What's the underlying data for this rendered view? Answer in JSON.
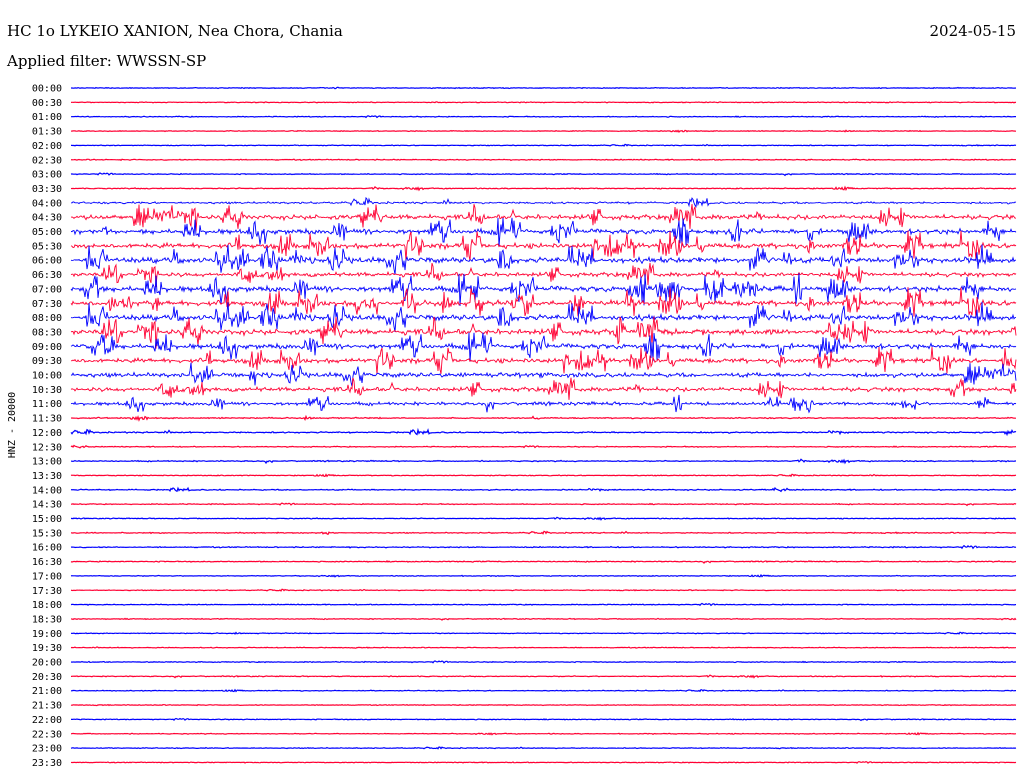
{
  "header": {
    "station": "HC 1o LYKEIO XANION, Nea Chora, Chania",
    "date": "2024-05-15",
    "filter": "Applied filter: WWSSN-SP"
  },
  "chart_data": {
    "type": "line",
    "subtype": "helicorder",
    "title": "HC 1o LYKEIO XANION, Nea Chora, Chania",
    "subtitle": "Applied filter: WWSSN-SP",
    "ylabel": "HNZ - 20000",
    "colors": {
      "even_row": "#0000ff",
      "odd_row": "#ff0033",
      "text": "#000000",
      "background": "#ffffff"
    },
    "rows": [
      {
        "label": "00:00",
        "activity": 0.05
      },
      {
        "label": "00:30",
        "activity": 0.04
      },
      {
        "label": "01:00",
        "activity": 0.05
      },
      {
        "label": "01:30",
        "activity": 0.04
      },
      {
        "label": "02:00",
        "activity": 0.04
      },
      {
        "label": "02:30",
        "activity": 0.08
      },
      {
        "label": "03:00",
        "activity": 0.06
      },
      {
        "label": "03:30",
        "activity": 0.08
      },
      {
        "label": "04:00",
        "activity": 0.3
      },
      {
        "label": "04:30",
        "activity": 0.85
      },
      {
        "label": "05:00",
        "activity": 0.9
      },
      {
        "label": "05:30",
        "activity": 0.95
      },
      {
        "label": "06:00",
        "activity": 1.0
      },
      {
        "label": "06:30",
        "activity": 0.75
      },
      {
        "label": "07:00",
        "activity": 1.0
      },
      {
        "label": "07:30",
        "activity": 1.0
      },
      {
        "label": "08:00",
        "activity": 1.0
      },
      {
        "label": "08:30",
        "activity": 1.0
      },
      {
        "label": "09:00",
        "activity": 0.9
      },
      {
        "label": "09:30",
        "activity": 0.85
      },
      {
        "label": "10:00",
        "activity": 0.8
      },
      {
        "label": "10:30",
        "activity": 0.75
      },
      {
        "label": "11:00",
        "activity": 0.55
      },
      {
        "label": "11:30",
        "activity": 0.12
      },
      {
        "label": "12:00",
        "activity": 0.15
      },
      {
        "label": "12:30",
        "activity": 0.06
      },
      {
        "label": "13:00",
        "activity": 0.1
      },
      {
        "label": "13:30",
        "activity": 0.05
      },
      {
        "label": "14:00",
        "activity": 0.1
      },
      {
        "label": "14:30",
        "activity": 0.06
      },
      {
        "label": "15:00",
        "activity": 0.06
      },
      {
        "label": "15:30",
        "activity": 0.08
      },
      {
        "label": "16:00",
        "activity": 0.1
      },
      {
        "label": "16:30",
        "activity": 0.08
      },
      {
        "label": "17:00",
        "activity": 0.04
      },
      {
        "label": "17:30",
        "activity": 0.04
      },
      {
        "label": "18:00",
        "activity": 0.06
      },
      {
        "label": "18:30",
        "activity": 0.05
      },
      {
        "label": "19:00",
        "activity": 0.04
      },
      {
        "label": "19:30",
        "activity": 0.04
      },
      {
        "label": "20:00",
        "activity": 0.06
      },
      {
        "label": "20:30",
        "activity": 0.06
      },
      {
        "label": "21:00",
        "activity": 0.04
      },
      {
        "label": "21:30",
        "activity": 0.04
      },
      {
        "label": "22:00",
        "activity": 0.05
      },
      {
        "label": "22:30",
        "activity": 0.04
      },
      {
        "label": "23:00",
        "activity": 0.05
      },
      {
        "label": "23:30",
        "activity": 0.04
      }
    ]
  }
}
